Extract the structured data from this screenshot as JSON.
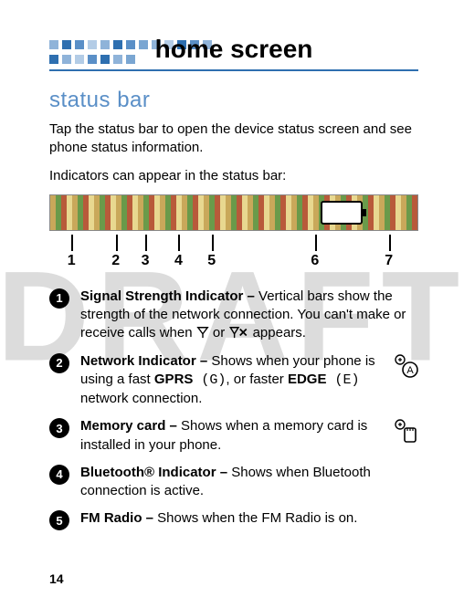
{
  "watermark": "DRAFT",
  "title": "home screen",
  "section_heading": "status bar",
  "intro1": "Tap the status bar to open the device status screen and see phone status information.",
  "intro2": "Indicators can appear in the status bar:",
  "ticks": [
    "1",
    "2",
    "3",
    "4",
    "5",
    "6",
    "7"
  ],
  "items": [
    {
      "num": "1",
      "title": "Signal Strength Indicator – ",
      "body_a": "Vertical bars show the strength of the network connection. You can't make or receive calls when ",
      "body_b": " or ",
      "body_c": " appears."
    },
    {
      "num": "2",
      "title": "Network Indicator – ",
      "body_a": "Shows when your phone is using a fast ",
      "bold_a": "GPRS",
      "paren_a": " (G)",
      "body_b": ", or faster ",
      "bold_b": "EDGE",
      "paren_b": " (E)",
      "body_c": " network connection."
    },
    {
      "num": "3",
      "title": "Memory card – ",
      "body": "Shows when a memory card is installed in your phone."
    },
    {
      "num": "4",
      "title": "Bluetooth® Indicator – ",
      "body": "Shows when Bluetooth connection is active."
    },
    {
      "num": "5",
      "title": "FM Radio – ",
      "body": "Shows when the FM Radio is on."
    }
  ],
  "page_number": "14"
}
